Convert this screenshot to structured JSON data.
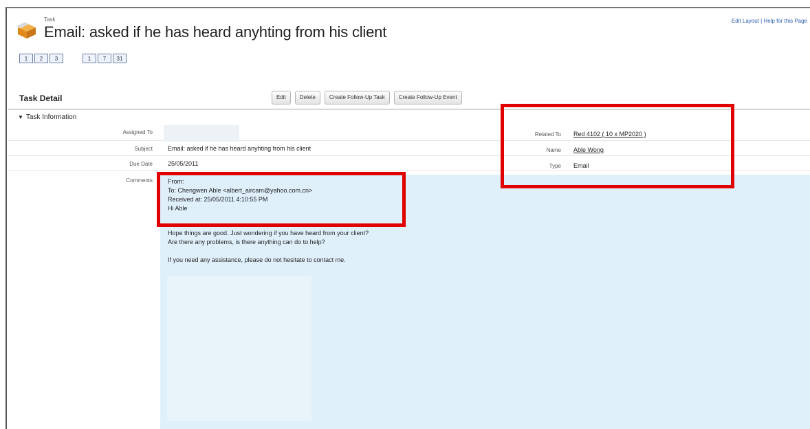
{
  "header": {
    "object_label": "Task",
    "title": "Email: asked if he has heard anyhting from his client",
    "links": "Edit Layout | Help for this Page"
  },
  "view_buttons": [
    "1",
    "2",
    "3",
    "1",
    "7",
    "31"
  ],
  "detail": {
    "title": "Task Detail",
    "buttons": [
      "Edit",
      "Delete",
      "Create Follow-Up Task",
      "Create Follow-Up Event"
    ]
  },
  "section": {
    "title": "Task Information"
  },
  "fields": {
    "assigned_to_label": "Assigned To",
    "subject_label": "Subject",
    "subject_value": "Email: asked if he has heard anyhting from his client",
    "due_date_label": "Due Date",
    "due_date_value": "25/05/2011",
    "comments_label": "Comments",
    "related_to_label": "Related To",
    "related_to_value": "Red 4102 ( 10 x MP2020 )",
    "name_label": "Name",
    "name_value": "Able Wong",
    "type_label": "Type",
    "type_value": "Email"
  },
  "comments": {
    "from": "From:",
    "to": "To: Chengwen Able <albert_aircam@yahoo.com.cn>",
    "received": "Received at: 25/05/2011 4:10:55 PM",
    "greeting": "Hi Able",
    "line1": "Hope things are good. Just wondering if you have heard from your client?",
    "line2": "Are there any problems, is there anything can do to help?",
    "line3": "If you need any assistance, please do not hesitate to contact me."
  },
  "colors": {
    "highlight_box": "#e00000",
    "comments_bg": "#dff0fb"
  }
}
